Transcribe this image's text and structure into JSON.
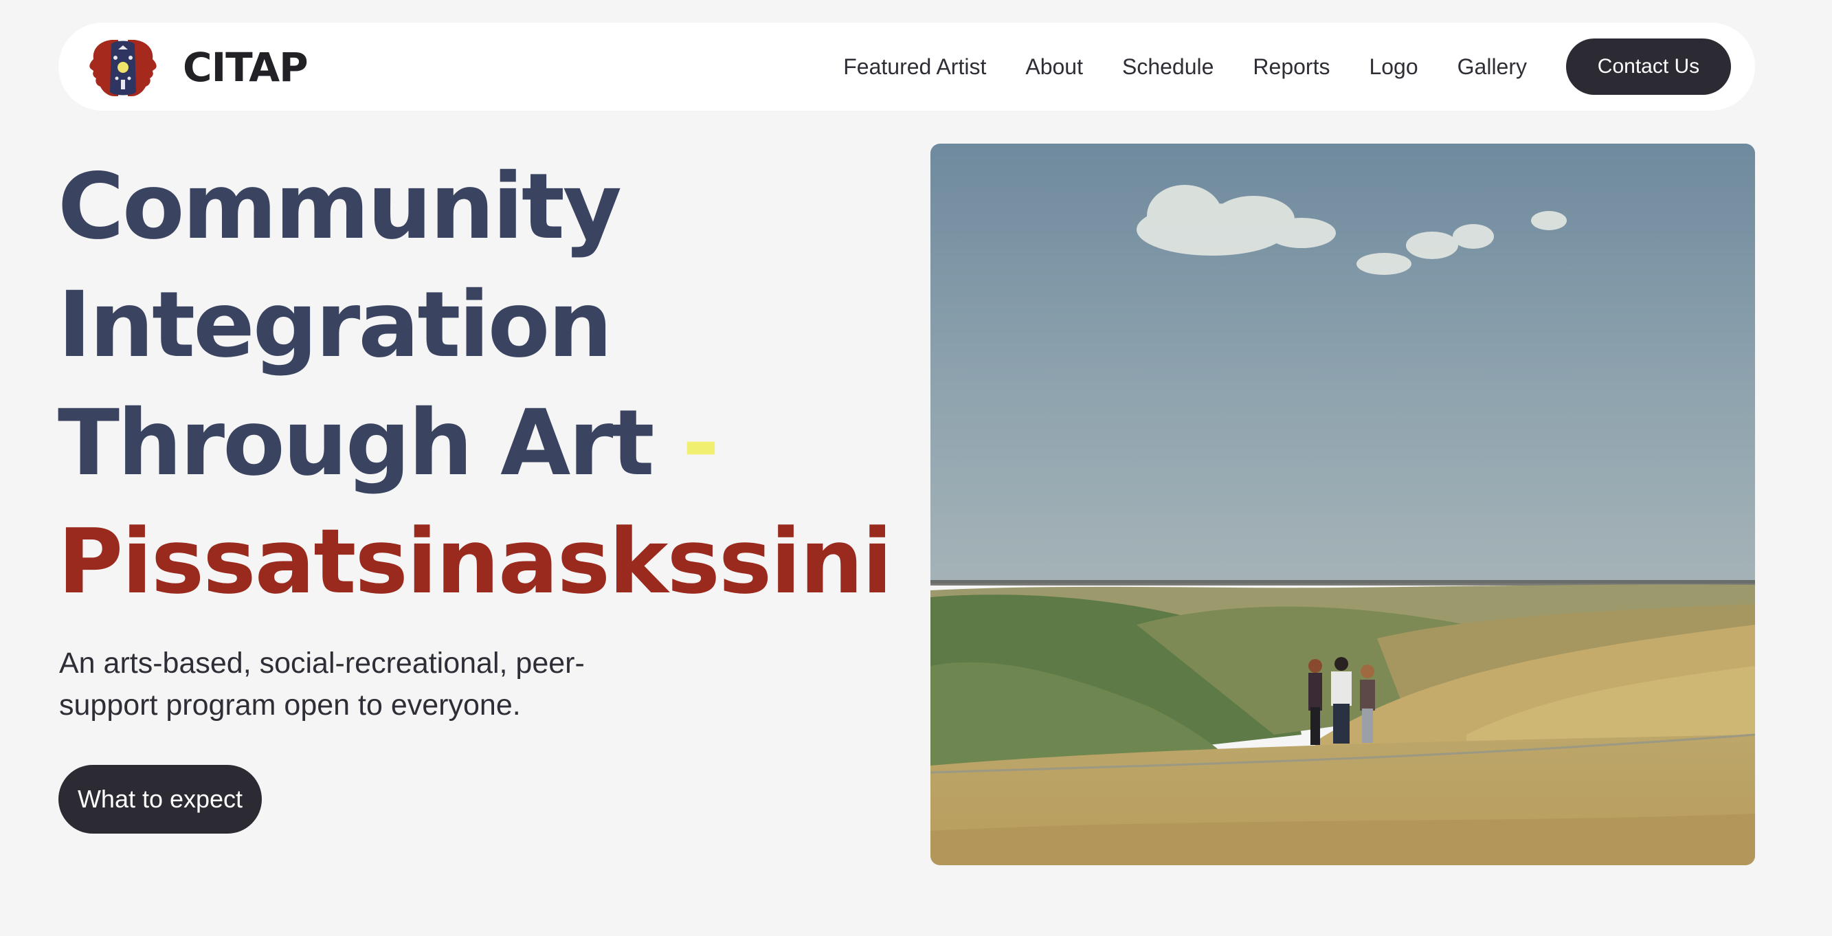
{
  "brand": {
    "name": "CITAP",
    "logo_icon": "twin-face-profile-logo"
  },
  "nav": {
    "items": [
      {
        "label": "Featured Artist"
      },
      {
        "label": "About"
      },
      {
        "label": "Schedule"
      },
      {
        "label": "Reports"
      },
      {
        "label": "Logo"
      },
      {
        "label": "Gallery"
      }
    ],
    "contact_label": "Contact Us"
  },
  "hero": {
    "headline_lines": [
      "Community",
      "Integration",
      "Through Art"
    ],
    "headline_dash": "-",
    "native_title": "Pissatsinaskssini",
    "subtext": "An arts-based, social-recreational,  peer-support program open to everyone.",
    "cta_label": "What to expect",
    "image_icon": "prairie-landscape-photo"
  },
  "colors": {
    "background": "#f5f5f6",
    "headline": "#3a435f",
    "native_title": "#9a2a1d",
    "dash_accent": "#f1ef6f",
    "button_dark": "#2c2a33",
    "button_text": "#ffffff"
  }
}
